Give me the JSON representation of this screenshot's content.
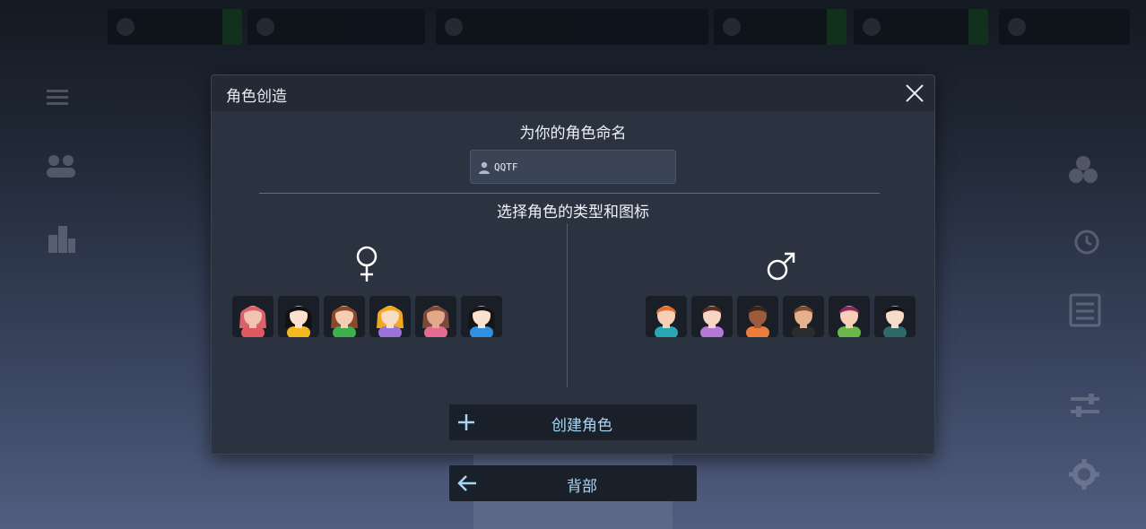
{
  "dialog": {
    "title": "角色创造",
    "name_prompt": "为你的角色命名",
    "name_value": "QQTF",
    "type_prompt": "选择角色的类型和图标",
    "female_symbol": "♀",
    "male_symbol": "♂",
    "create_label": "创建角色"
  },
  "footer": {
    "back_label": "背部"
  },
  "female_avatars": [
    {
      "hair": "#d9626c",
      "skin": "#f2c3b0",
      "shirt": "#e05860"
    },
    {
      "hair": "#111111",
      "skin": "#fbe1cf",
      "shirt": "#f5b81f"
    },
    {
      "hair": "#8a4a2a",
      "skin": "#f4cdb5",
      "shirt": "#3fae4c"
    },
    {
      "hair": "#f2a81d",
      "skin": "#f9dcc4",
      "shirt": "#9a72d8"
    },
    {
      "hair": "#7a4a38",
      "skin": "#e3a88a",
      "shirt": "#e46a90"
    },
    {
      "hair": "#151515",
      "skin": "#fbe1cf",
      "shirt": "#2f8fe0"
    }
  ],
  "male_avatars": [
    {
      "hair": "#e0702e",
      "skin": "#f6cfb6",
      "shirt": "#2aa7b5"
    },
    {
      "hair": "#5a2f22",
      "skin": "#f7d7c4",
      "shirt": "#b479d8"
    },
    {
      "hair": "#3a2418",
      "skin": "#9a5c3c",
      "shirt": "#ef7d3a"
    },
    {
      "hair": "#7a4a2a",
      "skin": "#e7b08c",
      "shirt": "#2c2c2c"
    },
    {
      "hair": "#8a2a5a",
      "skin": "#f6cfb6",
      "shirt": "#6ab84a"
    },
    {
      "hair": "#111111",
      "skin": "#f7dac8",
      "shirt": "#2d6a6a"
    }
  ],
  "colors": {
    "accent": "#a9d6f5",
    "dialog_bg": "#2b3340"
  }
}
